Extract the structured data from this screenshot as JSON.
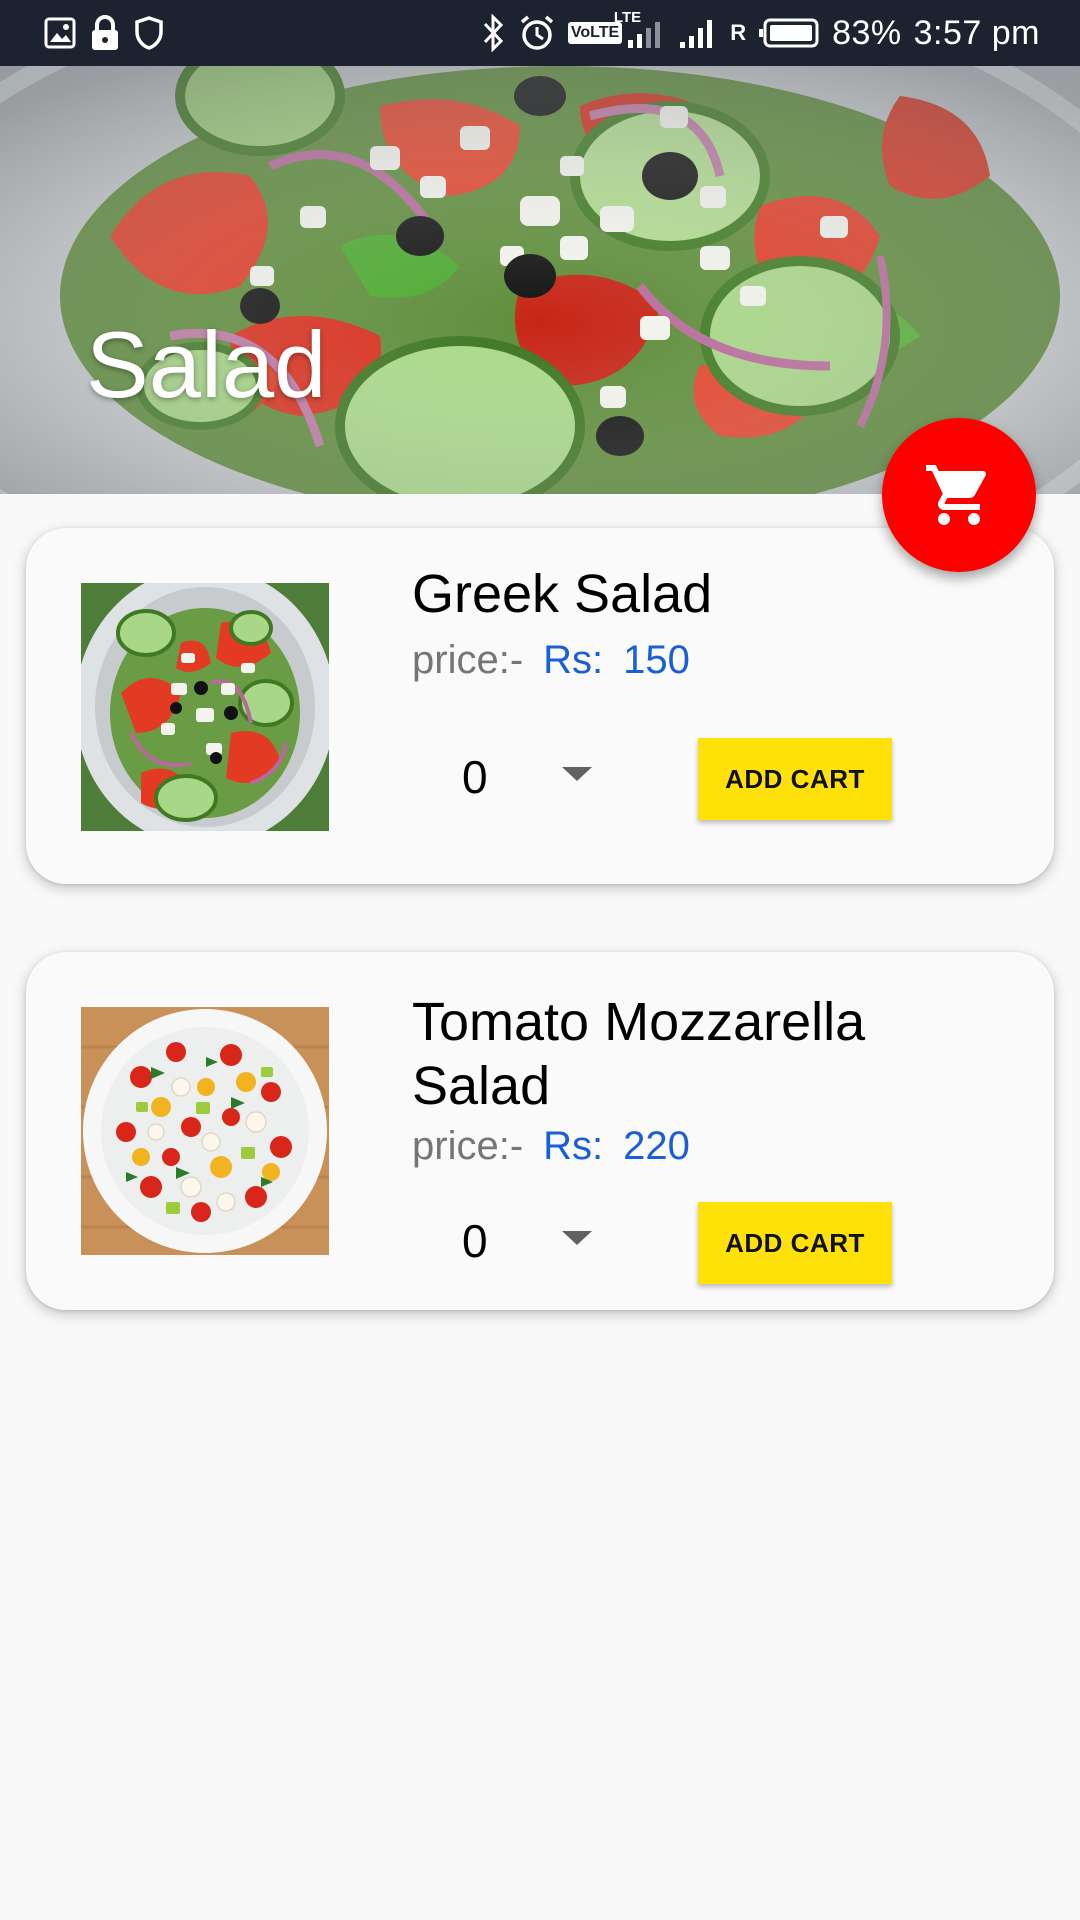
{
  "status_bar": {
    "battery": "83%",
    "time": "3:57 pm",
    "network_badge": "VoLTE",
    "network_tag": "LTE",
    "roaming": "R",
    "icons_left": [
      "gallery-icon",
      "lock-icon",
      "shield-icon"
    ],
    "icons_right": [
      "bluetooth-icon",
      "alarm-icon",
      "signal-icon",
      "battery-icon"
    ]
  },
  "header": {
    "title": "Salad",
    "image": "greek-salad-banner"
  },
  "fab": {
    "icon": "shopping-cart-icon",
    "color": "#ff0000"
  },
  "items": [
    {
      "name": "Greek Salad",
      "price_label": "price:-",
      "currency": "Rs:",
      "price": "150",
      "quantity": "0",
      "add_button": "ADD CART",
      "image": "greek-salad-thumbnail"
    },
    {
      "name": "Tomato Mozzarella Salad",
      "price_label": "price:-",
      "currency": "Rs:",
      "price": "220",
      "quantity": "0",
      "add_button": "ADD CART",
      "image": "tomato-mozzarella-thumbnail"
    }
  ],
  "colors": {
    "status_bar": "#1c2230",
    "price": "#1a5fd8",
    "add_button": "#ffe10a",
    "background": "#f9f9f9"
  }
}
